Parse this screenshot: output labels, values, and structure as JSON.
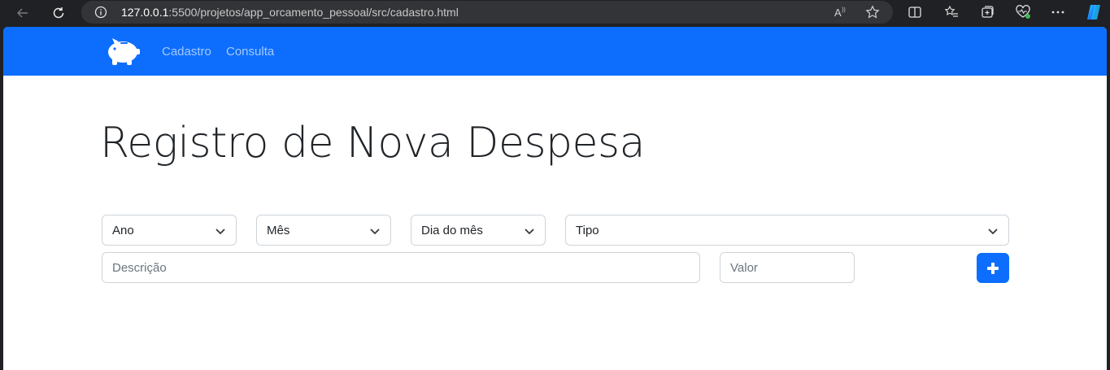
{
  "browser": {
    "url_host": "127.0.0.1",
    "url_rest": ":5500/projetos/app_orcamento_pessoal/src/cadastro.html"
  },
  "navbar": {
    "brand_icon": "piggy-bank-icon",
    "links": [
      "Cadastro",
      "Consulta"
    ],
    "background": "#0d6efd"
  },
  "main": {
    "title": "Registro de Nova Despesa",
    "selects": {
      "ano": "Ano",
      "mes": "Mês",
      "dia": "Dia do mês",
      "tipo": "Tipo"
    },
    "inputs": {
      "descricao_placeholder": "Descrição",
      "valor_placeholder": "Valor"
    },
    "add_button_icon": "plus-icon",
    "accent": "#0d6efd"
  }
}
